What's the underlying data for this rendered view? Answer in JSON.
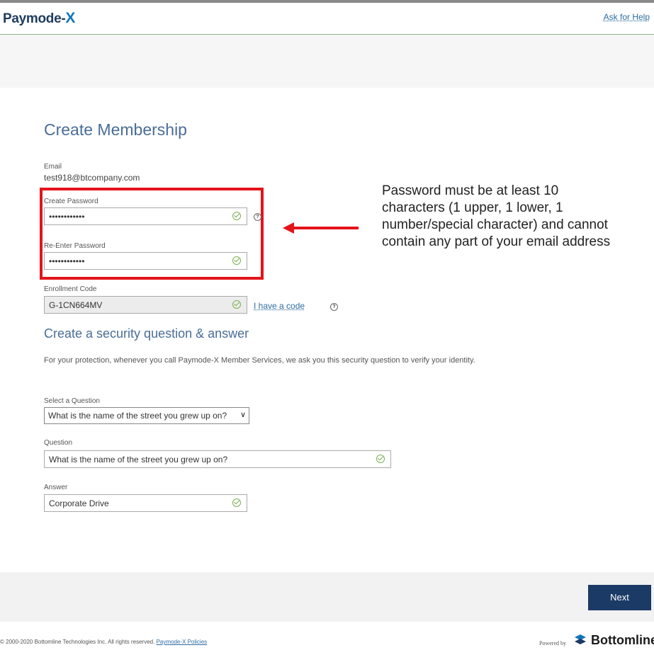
{
  "header": {
    "logo_text": "Paymode-",
    "logo_x": "X",
    "help_link": "Ask for Help"
  },
  "page": {
    "title": "Create Membership"
  },
  "email": {
    "label": "Email",
    "value": "test918@btcompany.com"
  },
  "password": {
    "create_label": "Create Password",
    "create_value": "••••••••••••",
    "reenter_label": "Re-Enter Password",
    "reenter_value": "••••••••••••",
    "help_icon": "?"
  },
  "annotation": {
    "note": "Password must be at least 10 characters (1 upper, 1 lower, 1 number/special character) and cannot contain any part of  your email address",
    "highlight_color": "#e4141b"
  },
  "enrollment": {
    "label": "Enrollment Code",
    "value": "G-1CN664MV",
    "have_code_link": "I have a code",
    "help_icon": "?"
  },
  "security": {
    "title": "Create a security question & answer",
    "description": "For your protection, whenever you call Paymode-X Member Services, we ask you this security question to verify your identity.",
    "select_label": "Select a Question",
    "select_value": "What is the name of the street you grew up on?",
    "question_label": "Question",
    "question_value": "What is the name of the street you grew up on?",
    "answer_label": "Answer",
    "answer_value": "Corporate Drive"
  },
  "actions": {
    "next_label": "Next"
  },
  "footer": {
    "copyright": "© 2000-2020 Bottomline Technologies Inc. All rights reserved.",
    "policies_link": "Paymode-X Policies",
    "powered_by": "Powered by",
    "brand": "Bottomline"
  },
  "colors": {
    "brand_navy": "#1c3a66",
    "heading_blue": "#4a6d98",
    "check_green": "#7ab050"
  },
  "icons": {
    "valid": "check-circle-icon",
    "help": "question-circle-icon",
    "dropdown": "chevron-down-icon"
  }
}
